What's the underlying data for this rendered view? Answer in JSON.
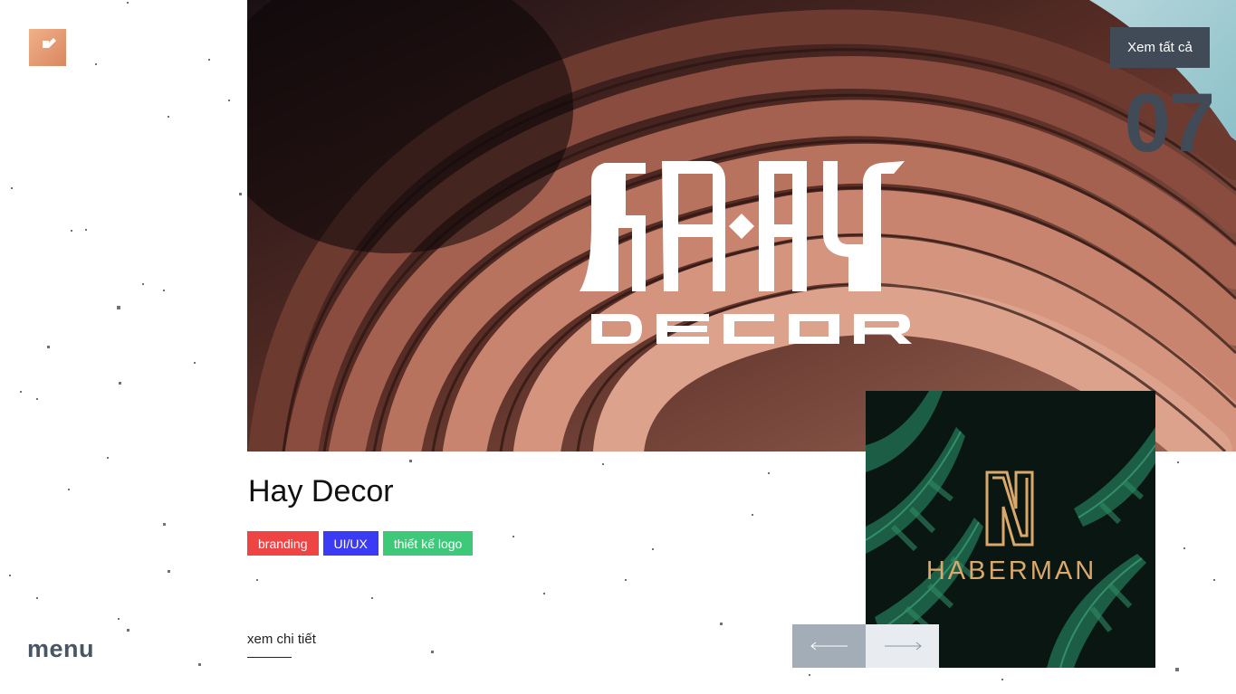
{
  "brand": {
    "logo_icon": "orange-square-logo-icon"
  },
  "menu": {
    "label": "menu"
  },
  "header": {
    "view_all_label": "Xem tất cả",
    "counter": "07"
  },
  "slide": {
    "image_wordmark": "HAY",
    "image_subtitle": "DECOR",
    "title": "Hay Decor",
    "tags": [
      {
        "label": "branding",
        "color": "#ef4444"
      },
      {
        "label": "UI/UX",
        "color": "#3b3bf5"
      },
      {
        "label": "thiết kế logo",
        "color": "#3ec87a"
      }
    ],
    "detail_link": "xem chi tiết"
  },
  "next_slide": {
    "brand_mark": "N",
    "brand_name": "HABERMAN"
  },
  "nav": {
    "prev_icon": "arrow-left-icon",
    "next_icon": "arrow-right-icon"
  },
  "colors": {
    "accent_dark": "#414a57",
    "gold": "#d9a86a"
  }
}
